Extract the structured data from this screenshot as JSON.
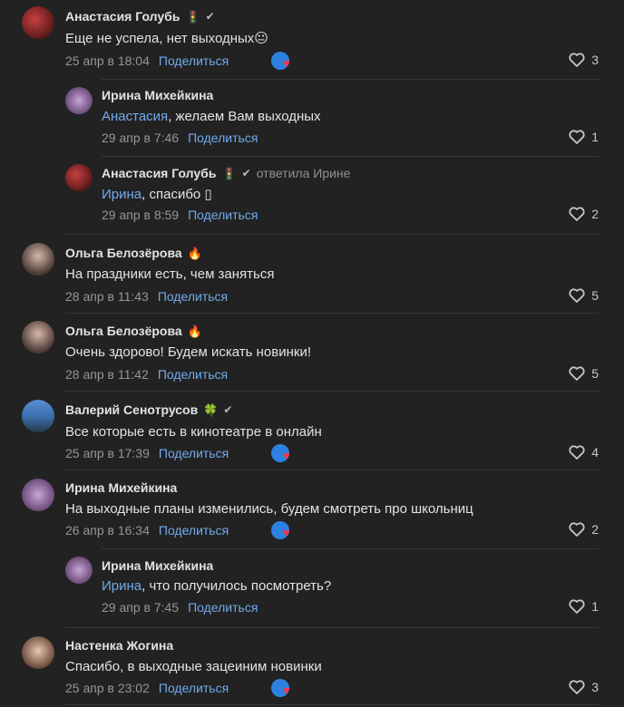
{
  "share_label": "Поделиться",
  "comments": [
    {
      "author": "Анастасия Голубь",
      "badge": "🚦",
      "verified": true,
      "text": "Еще не успела, нет выходных",
      "emoji": "😐",
      "date": "25 апр в 18:04",
      "likes": "3",
      "reaction": true
    },
    {
      "author": "Ирина Михейкина",
      "mention": "Анастасия",
      "text": ", желаем Вам выходных",
      "date": "29 апр в 7:46",
      "likes": "1"
    },
    {
      "author": "Анастасия Голубь",
      "badge": "🚦",
      "verified": true,
      "replied": "ответила Ирине",
      "mention": "Ирина",
      "text": ", спасибо ▯",
      "date": "29 апр в 8:59",
      "likes": "2"
    },
    {
      "author": "Ольга Белозёрова",
      "badge": "🔥",
      "text": "На праздники есть, чем заняться",
      "date": "28 апр в 11:43",
      "likes": "5"
    },
    {
      "author": "Ольга Белозёрова",
      "badge": "🔥",
      "text": "Очень здорово! Будем искать новинки!",
      "date": "28 апр в 11:42",
      "likes": "5"
    },
    {
      "author": "Валерий Сенотрусов",
      "badge": "🍀",
      "verified": true,
      "text": "Все которые есть в кинотеатре в онлайн",
      "date": "25 апр в 17:39",
      "likes": "4",
      "reaction": true
    },
    {
      "author": "Ирина Михейкина",
      "text": "На выходные планы изменились, будем смотреть про школьниц",
      "date": "26 апр в 16:34",
      "likes": "2",
      "reaction": true
    },
    {
      "author": "Ирина Михейкина",
      "mention": "Ирина",
      "text": ", что получилось посмотреть?",
      "date": "29 апр в 7:45",
      "likes": "1"
    },
    {
      "author": "Настенка Жогина",
      "text": "Спасибо, в выходные зацеиним новинки",
      "date": "25 апр в 23:02",
      "likes": "3",
      "reaction": true
    }
  ],
  "colors": {
    "background": "#222222",
    "link": "#71aaeb",
    "reaction_blue": "#2d81e0",
    "heart": "#ff3347"
  }
}
